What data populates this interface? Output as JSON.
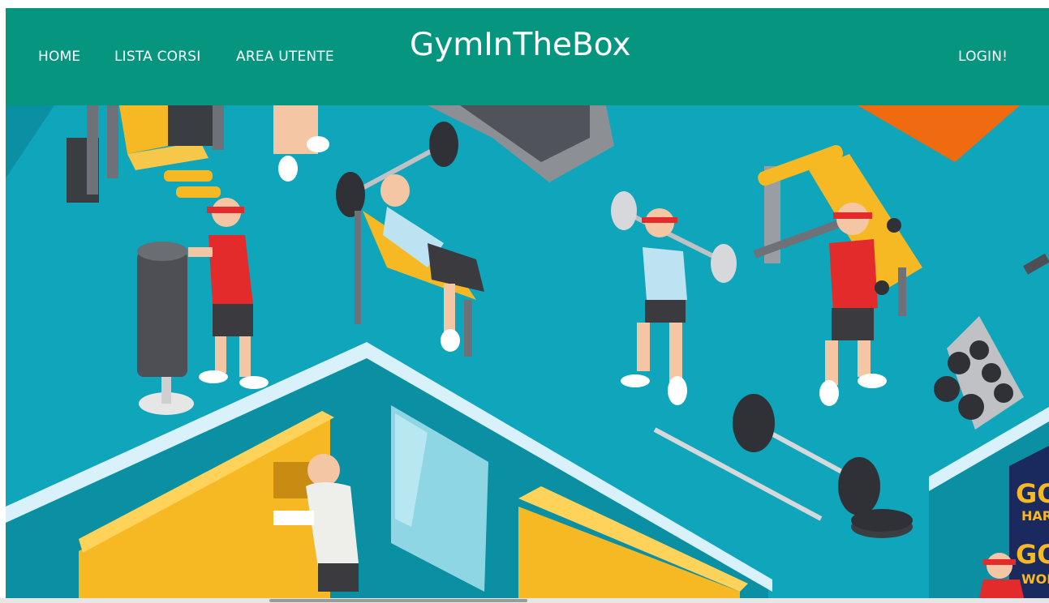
{
  "navbar": {
    "links": [
      {
        "label": "HOME"
      },
      {
        "label": "LISTA CORSI"
      },
      {
        "label": "AREA UTENTE"
      }
    ],
    "brand": "GymInTheBox",
    "login": "LOGIN!"
  },
  "hero": {
    "poster_text": [
      "GO",
      "HARD",
      "GO",
      "WORK"
    ]
  },
  "colors": {
    "navbar": "#06957f",
    "floor": "#0fa5ba",
    "locker": "#f6b923",
    "accent_orange": "#f06a0f"
  }
}
